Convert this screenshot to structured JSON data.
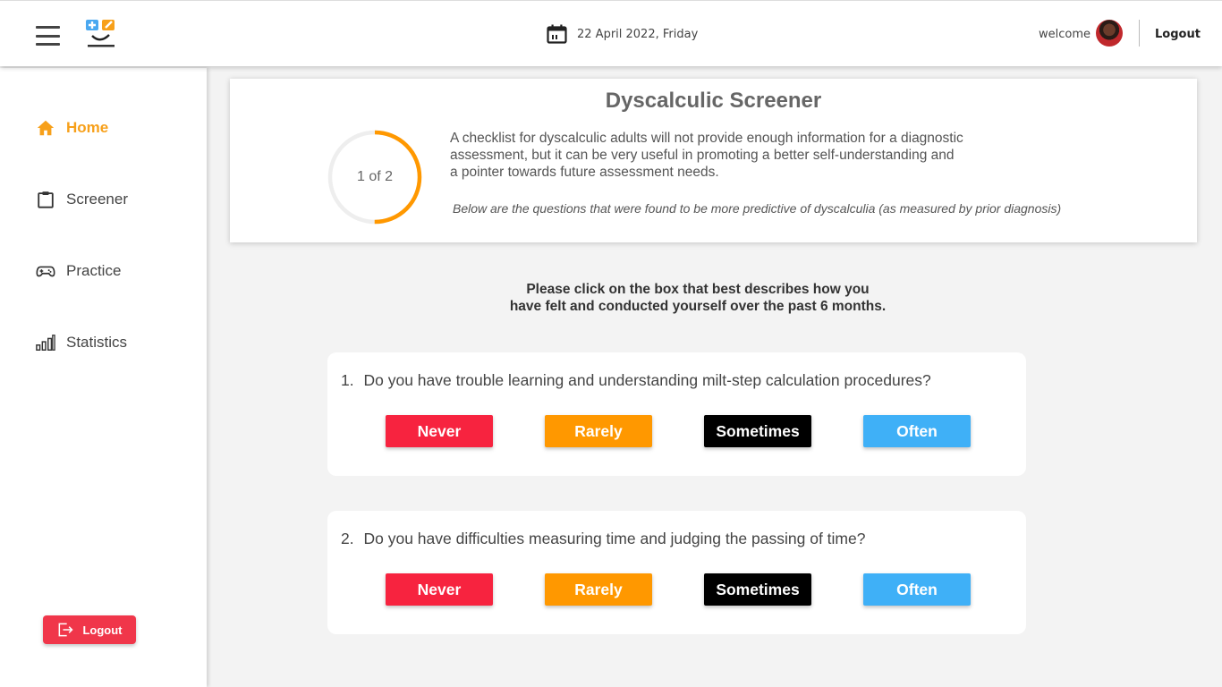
{
  "header": {
    "date": "22 April 2022, Friday",
    "welcome": "welcome",
    "logout_label": "Logout"
  },
  "sidebar": {
    "items": [
      {
        "label": "Home",
        "icon": "home-icon",
        "active": true
      },
      {
        "label": "Screener",
        "icon": "clipboard-icon",
        "active": false
      },
      {
        "label": "Practice",
        "icon": "gamepad-icon",
        "active": false
      },
      {
        "label": "Statistics",
        "icon": "bar-chart-icon",
        "active": false
      }
    ],
    "logout_label": "Logout"
  },
  "screener": {
    "title": "Dyscalculic Screener",
    "progress_label": "1 of 2",
    "progress_fraction": 0.5,
    "description_lines": [
      "A checklist for dyscalculic adults will not provide enough information for a diagnostic",
      "assessment, but it can be very useful in promoting a better self-understanding and",
      "a pointer towards future assessment needs."
    ],
    "note": "Below are the questions that were found to be more predictive of dyscalculia (as measured by prior diagnosis)"
  },
  "instructions": {
    "line1": "Please click on the box that best describes how you",
    "line2": "have felt and conducted yourself over the past 6 months."
  },
  "questions": [
    {
      "number": "1.",
      "text": "Do you have trouble learning and understanding milt-step calculation procedures?",
      "options": [
        "Never",
        "Rarely",
        "Sometimes",
        "Often"
      ]
    },
    {
      "number": "2.",
      "text": "Do you have difficulties measuring time and judging the passing of time?",
      "options": [
        "Never",
        "Rarely",
        "Sometimes",
        "Often"
      ]
    }
  ],
  "colors": {
    "accent": "#f7a01a",
    "never": "#f7233f",
    "rarely": "#ff9800",
    "sometimes": "#000000",
    "often": "#3fb0f7",
    "logout": "#f0364a"
  }
}
